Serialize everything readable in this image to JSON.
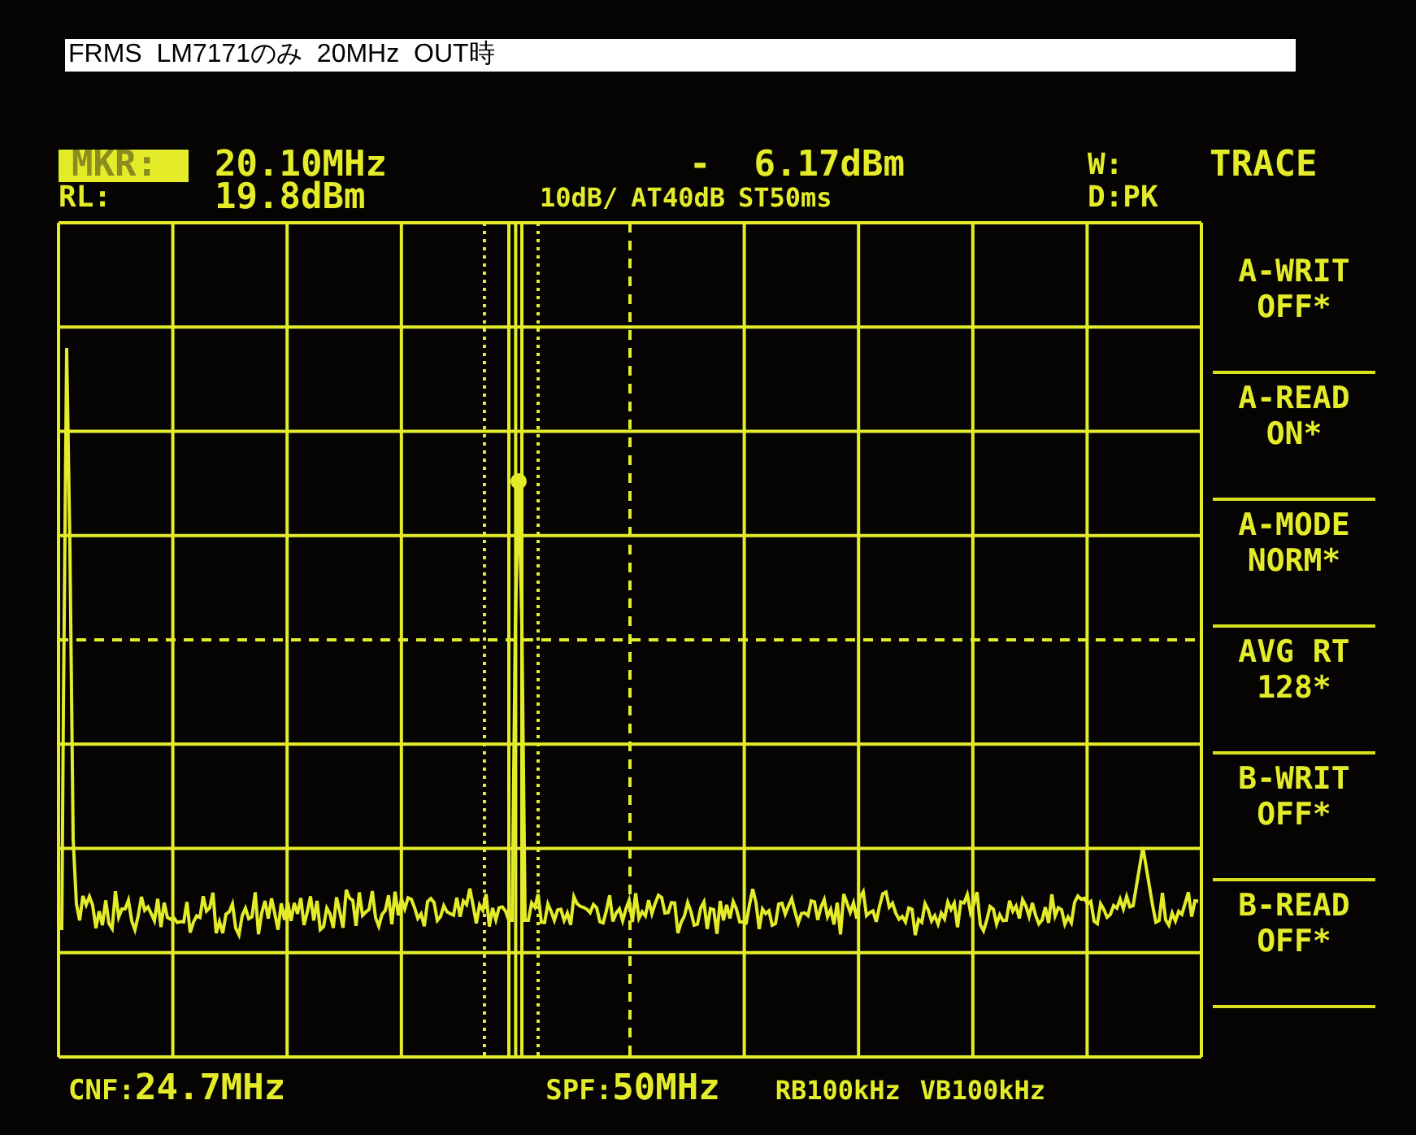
{
  "caption": "FRMS  LM7171のみ  20MHz  OUT時",
  "header": {
    "marker_label": "MKR:",
    "marker_freq": "20.10MHz",
    "marker_level": "-  6.17dBm",
    "w_label": "W:",
    "menu_title": "TRACE",
    "ref_label": "RL:",
    "ref_level": "19.8dBm",
    "scale": "10dB/",
    "attenuation": "AT40dB",
    "sweep_time": "ST50ms",
    "detector": "D:PK"
  },
  "softkeys": [
    {
      "label": "A-WRIT",
      "value": "OFF*"
    },
    {
      "label": "A-READ",
      "value": "ON*"
    },
    {
      "label": "A-MODE",
      "value": "NORM*"
    },
    {
      "label": "AVG RT",
      "value": "128*"
    },
    {
      "label": "B-WRIT",
      "value": "OFF*"
    },
    {
      "label": "B-READ",
      "value": "OFF*"
    }
  ],
  "footer": {
    "center_label": "CNF:",
    "center_value": "24.7MHz",
    "span_label": "SPF:",
    "span_value": "50MHz",
    "rbw": "RB100kHz",
    "vbw": "VB100kHz"
  }
}
